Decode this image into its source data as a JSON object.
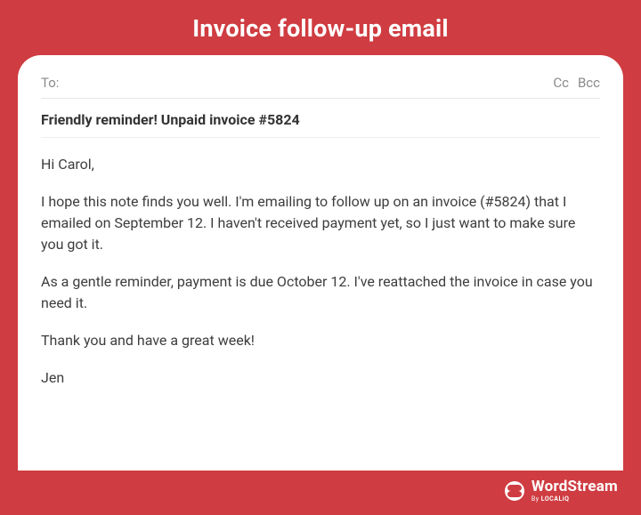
{
  "title": "Invoice follow-up email",
  "header": {
    "to_label": "To:",
    "cc_label": "Cc",
    "bcc_label": "Bcc"
  },
  "subject": "Friendly reminder! Unpaid invoice #5824",
  "body": {
    "greeting": "Hi Carol,",
    "p1": "I hope this note finds you well. I'm emailing to follow up on an invoice (#5824) that I emailed on September 12. I haven't received  payment yet, so I just want to make sure you got it.",
    "p2": "As a gentle reminder, payment is due October 12. I've reattached the invoice in case you need it.",
    "p3": "Thank you and have a great week!",
    "signoff": "Jen"
  },
  "brand": {
    "name": "WordStream",
    "by": "By ",
    "sub": "LOCALiQ"
  }
}
